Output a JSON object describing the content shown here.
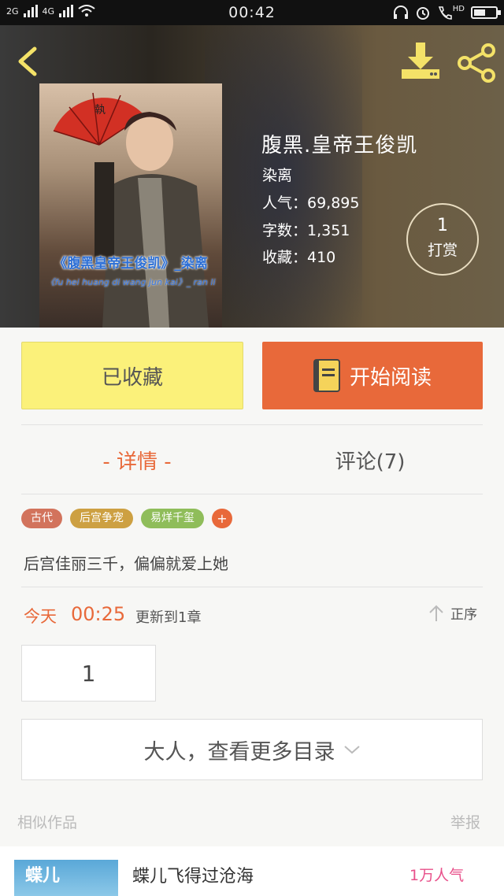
{
  "status_bar": {
    "signal_1": "2G",
    "signal_2": "4G",
    "time": "00:42",
    "hd": "HD"
  },
  "book": {
    "title": "腹黑.皇帝王俊凯",
    "author": "染离",
    "popularity": "人气：69,895",
    "words": "字数：1,351",
    "favorites": "收藏：410",
    "cover_title": "《腹黑皇帝王俊凯》_染离",
    "cover_subtitle": "《fu hei huang di wang jun kai》_ ran li",
    "cover_fan_char": "執"
  },
  "tip": {
    "count": "1",
    "label": "打赏"
  },
  "actions": {
    "collected_label": "已收藏",
    "start_read_label": "开始阅读"
  },
  "tabs": {
    "detail_label": "- 详情 -",
    "comments_label": "评论(7)"
  },
  "tags": [
    {
      "label": "古代",
      "color": "#d2735c"
    },
    {
      "label": "后宫争宠",
      "color": "#cda042"
    },
    {
      "label": "易烊千玺",
      "color": "#8fbd5a"
    }
  ],
  "tag_add": "+",
  "intro": "后宫佳丽三千，偏偏就爱上她",
  "update": {
    "today": "今天",
    "time": "00:25",
    "text": "更新到1章",
    "sort_label": "正序"
  },
  "chapter_box": "1",
  "more_catalog": "大人，查看更多目录",
  "similar": {
    "section_label": "相似作品",
    "report_label": "举报",
    "items": [
      {
        "title": "蝶儿飞得过沧海",
        "popularity": "1万人气",
        "thumb_text": "蝶儿"
      }
    ]
  },
  "colors": {
    "accent": "#e8693a",
    "collected_bg": "#fbf17a",
    "popularity_pink": "#e8508a"
  }
}
